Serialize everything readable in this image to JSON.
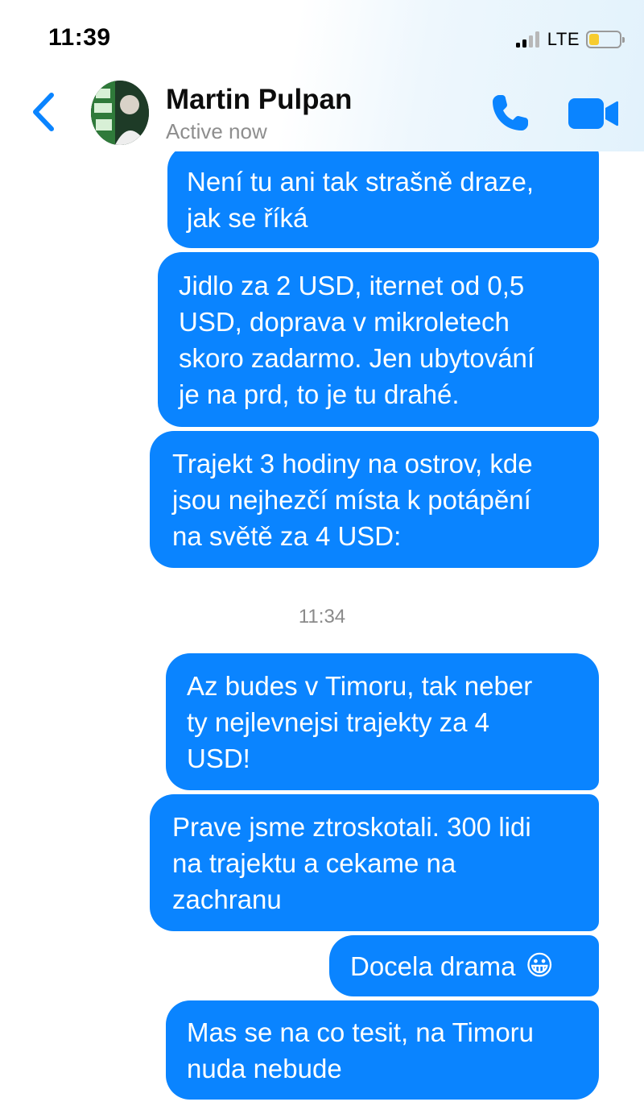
{
  "status_bar": {
    "time": "11:39",
    "network": "LTE"
  },
  "header": {
    "contact_name": "Martin Pulpan",
    "contact_status": "Active now"
  },
  "avatar": {
    "alt": "profile picture"
  },
  "colors": {
    "bubble": "#0a84ff",
    "accent": "#0a84ff",
    "battery_fill": "#f7cc2f"
  },
  "icons": {
    "back": "chevron-left-icon",
    "call": "phone-icon",
    "video": "video-camera-icon"
  },
  "messages": [
    {
      "text": "Není tu ani tak strašně draze,\njak se říká"
    },
    {
      "text": "Jidlo za 2 USD, iternet od 0,5\nUSD, doprava v mikroletech\nskoro zadarmo. Jen ubytování\nje na prd, to je tu drahé."
    },
    {
      "text": "Trajekt 3 hodiny na ostrov, kde\njsou nejhezčí místa k potápění\nna světě za 4 USD:"
    },
    {
      "text": "Az budes v Timoru, tak neber\nty nejlevnejsi trajekty za 4\nUSD!"
    },
    {
      "text": "Prave jsme ztroskotali. 300 lidi\nna trajektu a cekame na\nzachranu"
    },
    {
      "text": "Docela drama",
      "emoji": "😀"
    },
    {
      "text": "Mas se na co tesit, na Timoru\nnuda nebude"
    }
  ],
  "timestamp": "11:34"
}
